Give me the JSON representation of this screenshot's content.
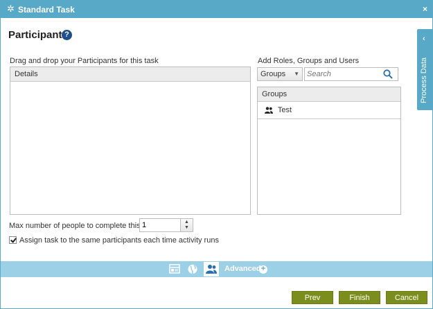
{
  "window": {
    "title": "Standard Task",
    "close": "×"
  },
  "page": {
    "heading": "Participants",
    "help": "?"
  },
  "left": {
    "drag_label": "Drag and drop your Participants for this task",
    "column_header": "Details"
  },
  "right": {
    "add_label": "Add Roles, Groups and Users",
    "type_selected": "Groups",
    "search_placeholder": "Search",
    "column_header": "Groups",
    "items": [
      {
        "label": "Test"
      }
    ]
  },
  "side_tab": {
    "label": "Process Data"
  },
  "settings": {
    "max_label": "Max number of people to complete this task:",
    "max_value": "1",
    "assign_label": "Assign task to the same participants each time activity runs",
    "assign_checked": true
  },
  "toolbar": {
    "advanced_label": "Advanced"
  },
  "buttons": {
    "prev": "Prev",
    "finish": "Finish",
    "cancel": "Cancel"
  },
  "colors": {
    "accent": "#58a8c8",
    "toolbar": "#9bd0e6",
    "button": "#7b8d1c"
  }
}
